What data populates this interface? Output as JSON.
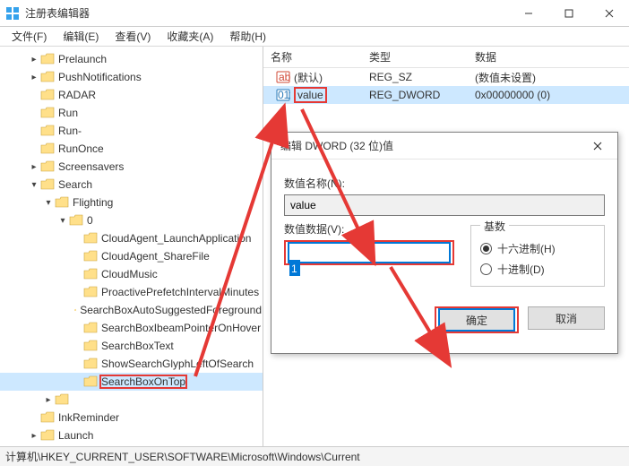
{
  "window": {
    "title": "注册表编辑器"
  },
  "menu": {
    "file": "文件(F)",
    "edit": "编辑(E)",
    "view": "查看(V)",
    "favorites": "收藏夹(A)",
    "help": "帮助(H)"
  },
  "tree": {
    "items": [
      {
        "indent": 2,
        "twisty": ">",
        "label": "Prelaunch"
      },
      {
        "indent": 2,
        "twisty": ">",
        "label": "PushNotifications"
      },
      {
        "indent": 2,
        "twisty": "",
        "label": "RADAR"
      },
      {
        "indent": 2,
        "twisty": "",
        "label": "Run"
      },
      {
        "indent": 2,
        "twisty": "",
        "label": "Run-"
      },
      {
        "indent": 2,
        "twisty": "",
        "label": "RunOnce"
      },
      {
        "indent": 2,
        "twisty": ">",
        "label": "Screensavers"
      },
      {
        "indent": 2,
        "twisty": "v",
        "label": "Search"
      },
      {
        "indent": 3,
        "twisty": "v",
        "label": "Flighting"
      },
      {
        "indent": 4,
        "twisty": "v",
        "label": "0"
      },
      {
        "indent": 5,
        "twisty": "",
        "label": "CloudAgent_LaunchApplication"
      },
      {
        "indent": 5,
        "twisty": "",
        "label": "CloudAgent_ShareFile"
      },
      {
        "indent": 5,
        "twisty": "",
        "label": "CloudMusic"
      },
      {
        "indent": 5,
        "twisty": "",
        "label": "ProactivePrefetchIntervalMinutes"
      },
      {
        "indent": 5,
        "twisty": "",
        "label": "SearchBoxAutoSuggestedForeground"
      },
      {
        "indent": 5,
        "twisty": "",
        "label": "SearchBoxIbeamPointerOnHover"
      },
      {
        "indent": 5,
        "twisty": "",
        "label": "SearchBoxText"
      },
      {
        "indent": 5,
        "twisty": "",
        "label": "ShowSearchGlyphLeftOfSearch"
      },
      {
        "indent": 5,
        "twisty": "",
        "label": "SearchBoxOnTop",
        "selected": true,
        "highlight": true
      },
      {
        "indent": 3,
        "twisty": ">",
        "label": ""
      },
      {
        "indent": 2,
        "twisty": "",
        "label": "InkReminder"
      },
      {
        "indent": 2,
        "twisty": ">",
        "label": "Launch"
      }
    ]
  },
  "list": {
    "headers": {
      "name": "名称",
      "type": "类型",
      "data": "数据"
    },
    "rows": [
      {
        "icon": "str",
        "name": "(默认)",
        "type": "REG_SZ",
        "data": "(数值未设置)"
      },
      {
        "icon": "bin",
        "name": "value",
        "type": "REG_DWORD",
        "data": "0x00000000 (0)",
        "selected": true,
        "highlight": true
      }
    ]
  },
  "dialog": {
    "title": "编辑 DWORD (32 位)值",
    "name_label": "数值名称(N):",
    "name_value": "value",
    "data_label": "数值数据(V):",
    "data_value": "1",
    "base_label": "基数",
    "hex_label": "十六进制(H)",
    "dec_label": "十进制(D)",
    "ok": "确定",
    "cancel": "取消"
  },
  "statusbar": {
    "path": "计算机\\HKEY_CURRENT_USER\\SOFTWARE\\Microsoft\\Windows\\Current"
  }
}
